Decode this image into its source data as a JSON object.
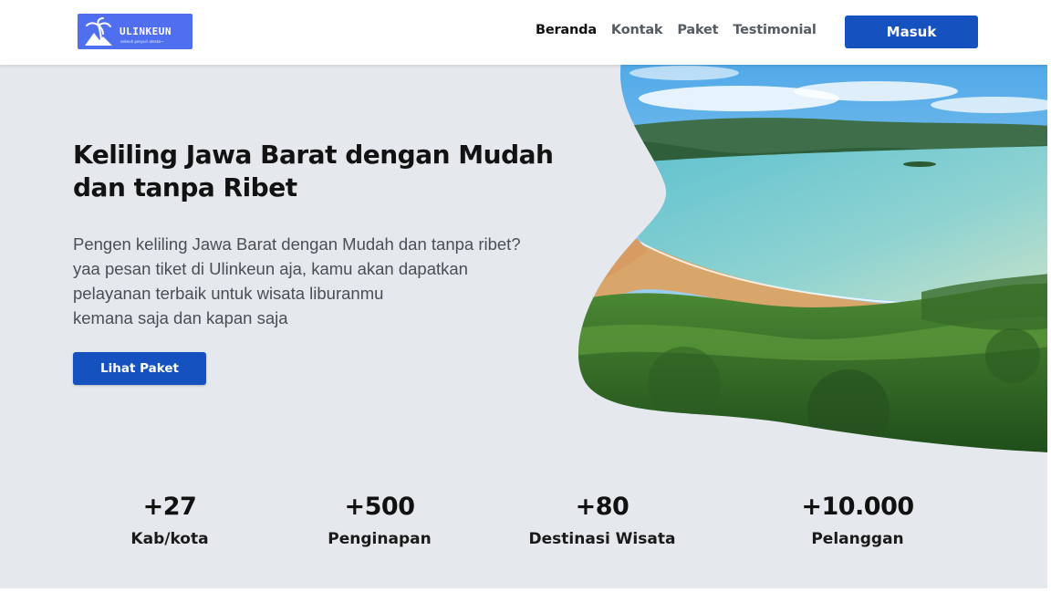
{
  "brand": {
    "name": "ULINKEUN",
    "tagline": "sekeuh pesyuri alesko~"
  },
  "nav": {
    "links": [
      {
        "label": "Beranda",
        "active": true
      },
      {
        "label": "Kontak",
        "active": false
      },
      {
        "label": "Paket",
        "active": false
      },
      {
        "label": "Testimonial",
        "active": false
      }
    ],
    "login_label": "Masuk"
  },
  "hero": {
    "title": "Keliling Jawa Barat dengan Mudah dan tanpa Ribet",
    "description": "Pengen keliling Jawa Barat dengan Mudah dan tanpa ribet?\nyaa pesan tiket di Ulinkeun aja, kamu akan dapatkan\npelayanan terbaik untuk wisata liburanmu\nkemana saja dan kapan saja",
    "cta_label": "Lihat Paket"
  },
  "stats": [
    {
      "value": "+27",
      "label": "Kab/kota"
    },
    {
      "value": "+500",
      "label": "Penginapan"
    },
    {
      "value": "+80",
      "label": "Destinasi Wisata"
    },
    {
      "value": "+10.000",
      "label": "Pelanggan"
    }
  ],
  "colors": {
    "primary": "#1552c0",
    "logo_bg": "#4f6ff0",
    "hero_bg": "#e5e8ec"
  }
}
